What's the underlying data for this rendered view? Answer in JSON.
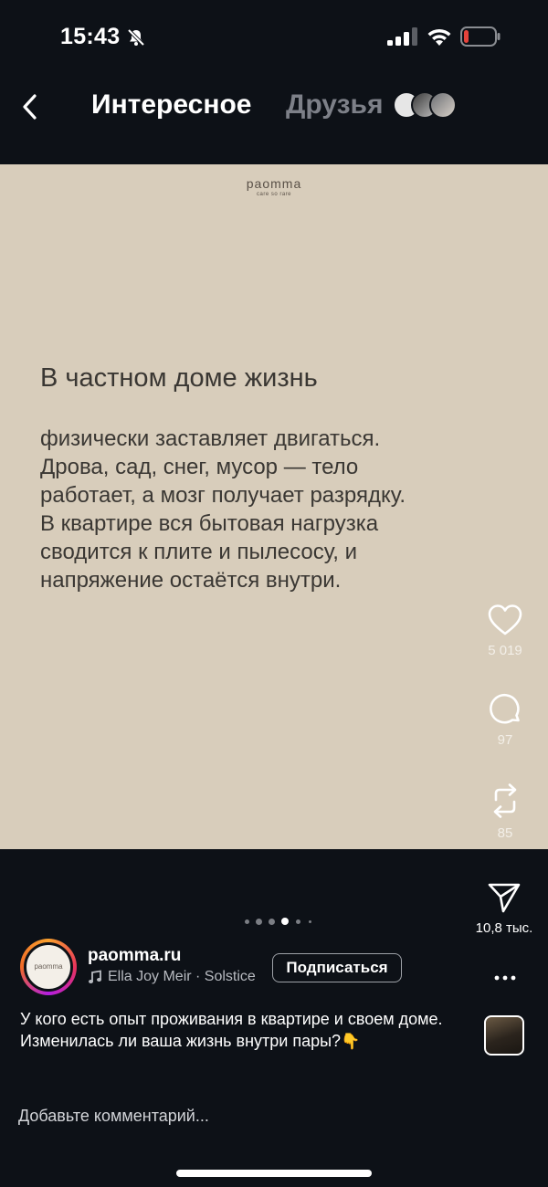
{
  "status_bar": {
    "time": "15:43"
  },
  "header": {
    "tab_interesting": "Интересное",
    "tab_friends": "Друзья"
  },
  "post": {
    "brand_name": "paomma",
    "brand_tagline": "care so rare",
    "heading": "В частном доме жизнь",
    "body_lines": [
      "физически заставляет двигаться.",
      "Дрова, сад, снег, мусор — тело",
      "работает, а мозг получает разрядку.",
      "В квартире вся бытовая нагрузка",
      "сводится к плите и пылесосу, и",
      "напряжение остаётся внутри."
    ]
  },
  "actions": {
    "likes": "5 019",
    "comments": "97",
    "reposts": "85",
    "shares": "10,8 тыс."
  },
  "carousel": {
    "total": 6,
    "active_index": 3
  },
  "author": {
    "name": "paomma.ru",
    "avatar_text": "paomma",
    "music": "Ella Joy Meir · Solstice",
    "subscribe_label": "Подписаться"
  },
  "caption": {
    "text": "У кого есть опыт проживания в квартире и своем доме. Изменилась ли ваша жизнь внутри пары?",
    "emoji": "👇"
  },
  "comment": {
    "placeholder": "Добавьте комментарий..."
  },
  "icons": [
    "mute-icon",
    "signal-icon",
    "wifi-icon",
    "battery-icon",
    "back-icon",
    "heart-icon",
    "comment-icon",
    "repost-icon",
    "send-icon",
    "music-icon",
    "more-icon"
  ],
  "colors": {
    "background": "#0d1117",
    "post_background": "#d8cdbb",
    "battery_low": "#e5433b"
  }
}
